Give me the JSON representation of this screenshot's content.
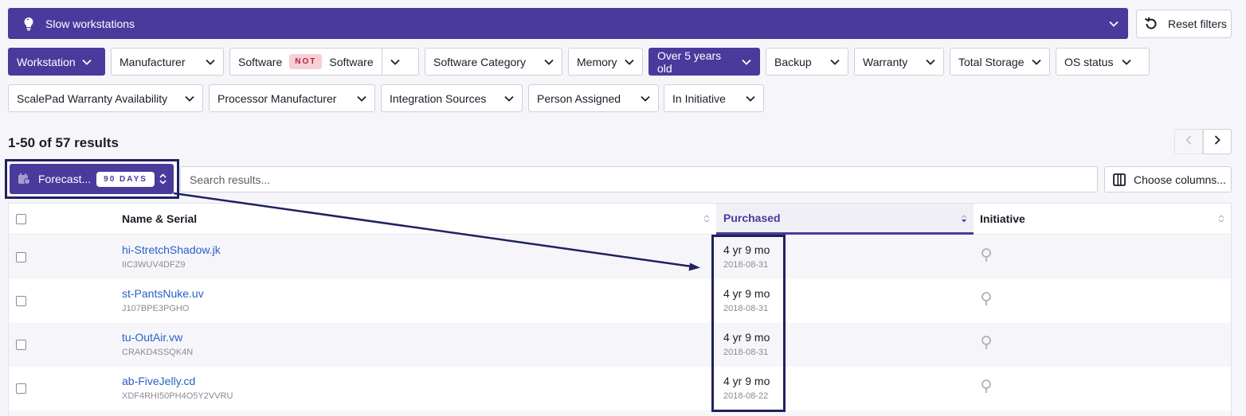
{
  "initiative_bar": {
    "title": "Slow workstations",
    "icon": "lightbulb-icon"
  },
  "reset_filters": {
    "label": "Reset filters",
    "icon": "reset-icon"
  },
  "filters": {
    "row1": [
      {
        "label": "Workstation",
        "active": true
      },
      {
        "label": "Manufacturer",
        "active": false
      },
      {
        "label": "Software",
        "not_badge": "NOT",
        "value": "Software",
        "active": false
      },
      {
        "label": "Software Category",
        "active": false
      },
      {
        "label": "Memory",
        "active": false
      },
      {
        "label": "Over 5 years old",
        "active": true
      },
      {
        "label": "Backup",
        "active": false
      },
      {
        "label": "Warranty",
        "active": false
      },
      {
        "label": "Total Storage",
        "active": false
      },
      {
        "label": "OS status",
        "active": false
      }
    ],
    "row2": [
      {
        "label": "ScalePad Warranty Availability",
        "active": false
      },
      {
        "label": "Processor Manufacturer",
        "active": false
      },
      {
        "label": "Integration Sources",
        "active": false
      },
      {
        "label": "Person Assigned",
        "active": false
      },
      {
        "label": "In Initiative",
        "active": false
      }
    ]
  },
  "results": {
    "summary": "1-50 of 57 results"
  },
  "forecast": {
    "label": "Forecast...",
    "badge": "90 DAYS"
  },
  "search": {
    "placeholder": "Search results...",
    "value": ""
  },
  "choose_columns": {
    "label": "Choose columns..."
  },
  "table": {
    "columns": [
      "Name & Serial",
      "Purchased",
      "Initiative"
    ],
    "sorted_column": "Purchased",
    "rows": [
      {
        "name": "hi-StretchShadow.jk",
        "serial": "IIC3WUV4DFZ9",
        "purchased_age": "4 yr 9 mo",
        "purchased_date": "2018-08-31"
      },
      {
        "name": "st-PantsNuke.uv",
        "serial": "J107BPE3PGHO",
        "purchased_age": "4 yr 9 mo",
        "purchased_date": "2018-08-31"
      },
      {
        "name": "tu-OutAir.vw",
        "serial": "CRAKD4SSQK4N",
        "purchased_age": "4 yr 9 mo",
        "purchased_date": "2018-08-31"
      },
      {
        "name": "ab-FiveJelly.cd",
        "serial": "XDF4RHI50PH4O5Y2VVRU",
        "purchased_age": "4 yr 9 mo",
        "purchased_date": "2018-08-22"
      }
    ]
  },
  "colors": {
    "accent": "#4a3a9c",
    "annotation": "#1f2160",
    "link": "#2860c6",
    "not_badge_bg": "#f7cfd5"
  }
}
